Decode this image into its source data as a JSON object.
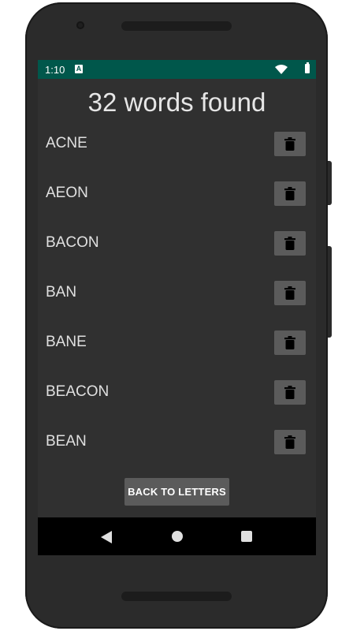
{
  "status_bar": {
    "time": "1:10",
    "notification_icon": "A",
    "icons": [
      "wifi-icon",
      "battery-icon"
    ]
  },
  "title": "32 words found",
  "words": [
    {
      "label": "ACNE"
    },
    {
      "label": "AEON"
    },
    {
      "label": "BACON"
    },
    {
      "label": "BAN"
    },
    {
      "label": "BANE"
    },
    {
      "label": "BEACON"
    },
    {
      "label": "BEAN"
    }
  ],
  "delete_icon": "trash-icon",
  "back_button_label": "BACK TO LETTERS",
  "nav_bar": {
    "icons": [
      "back-icon",
      "home-icon",
      "recents-icon"
    ]
  },
  "colors": {
    "status_bar": "#00574b",
    "background": "#303030",
    "button": "#5b5b5b",
    "text": "#e0e0e0"
  }
}
